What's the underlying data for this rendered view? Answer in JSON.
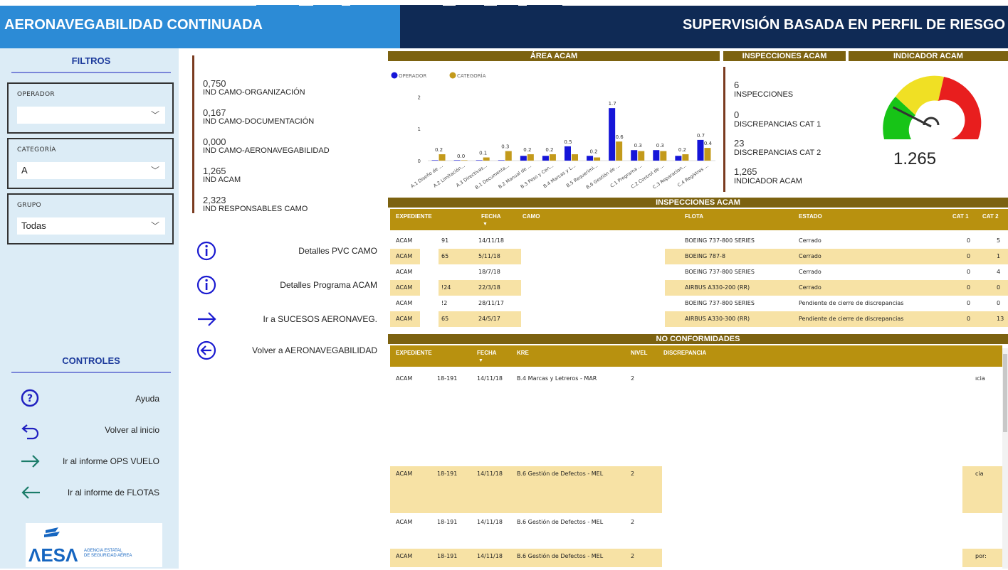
{
  "header": {
    "left_title": "AERONAVEGABILIDAD CONTINUADA",
    "right_title": "SUPERVISIÓN BASADA EN PERFIL DE RIESGO"
  },
  "filters": {
    "title": "FILTROS",
    "operador": {
      "label": "OPERADOR",
      "value": ""
    },
    "categoria": {
      "label": "CATEGORÍA",
      "value": "A"
    },
    "grupo": {
      "label": "GRUPO",
      "value": "Todas"
    }
  },
  "controls": {
    "title": "CONTROLES",
    "items": [
      {
        "label": "Ayuda",
        "icon": "help-icon"
      },
      {
        "label": "Volver al inicio",
        "icon": "back-arrow-icon"
      },
      {
        "label": "Ir al informe OPS VUELO",
        "icon": "arrow-right-icon"
      },
      {
        "label": "Ir al informe de FLOTAS",
        "icon": "arrow-left-icon"
      }
    ]
  },
  "logo": {
    "name": "AESA",
    "subtitle_1": "AGENCIA ESTATAL",
    "subtitle_2": "DE SEGURIDAD AÉREA"
  },
  "kpis": [
    {
      "value": "0,750",
      "label": "IND CAMO-ORGANIZACIÓN"
    },
    {
      "value": "0,167",
      "label": "IND CAMO-DOCUMENTACIÓN"
    },
    {
      "value": "0,000",
      "label": "IND CAMO-AERONAVEGABILIDAD"
    },
    {
      "value": "1,265",
      "label": "IND ACAM"
    },
    {
      "value": "2,323",
      "label": "IND RESPONSABLES CAMO"
    }
  ],
  "nav_links": [
    {
      "label": "Detalles PVC CAMO",
      "icon": "info-icon"
    },
    {
      "label": "Detalles Programa ACAM",
      "icon": "info-icon"
    },
    {
      "label": "Ir a SUCESOS AERONAVEG.",
      "icon": "arrow-right-icon"
    },
    {
      "label": "Volver a AERONAVEGABILIDAD",
      "icon": "circle-arrow-left-icon"
    }
  ],
  "sections": {
    "area_acam": "ÁREA ACAM",
    "inspecciones_acam": "INSPECCIONES ACAM",
    "indicador_acam": "INDICADOR ACAM",
    "inspecciones_table": "INSPECCIONES ACAM",
    "no_conformidades": "NO CONFORMIDADES"
  },
  "chart_data": {
    "type": "bar",
    "categories": [
      "A.1 Diseño de ...",
      "A.2 Limitación...",
      "A.3 Directivas...",
      "B.1 Documenta...",
      "B.2 Manual de ...",
      "B.3 Peso y Cen...",
      "B.4 Marcas y L...",
      "B.5 Requerimi...",
      "B.6 Gestión de ...",
      "C.1 Programa ...",
      "C.2 Control de ...",
      "C.3 Reparacion...",
      "C.4 Registros ..."
    ],
    "series": [
      {
        "name": "OPERADOR",
        "color": "#1515d8",
        "values": [
          0,
          0,
          0,
          0,
          0.15,
          0.15,
          0.45,
          0.15,
          1.65,
          0.33,
          0.33,
          0.15,
          0.65
        ]
      },
      {
        "name": "CATEGORÍA",
        "color": "#c39a1b",
        "values": [
          0.2,
          0.0,
          0.1,
          0.3,
          0.2,
          0.2,
          0.2,
          0.1,
          0.6,
          0.3,
          0.3,
          0.2,
          0.4
        ]
      }
    ],
    "data_labels": [
      "0.2",
      "0.0",
      "0.1",
      "0.3",
      "0.2",
      "0.2",
      "0.5",
      "0.2",
      "1.7",
      "0.6",
      "0.3",
      "0.3",
      "0.2",
      "0.7",
      "0.4"
    ],
    "y_ticks": [
      "0",
      "1",
      "2"
    ],
    "ylim": [
      0,
      2.1
    ],
    "legend_position": "top-left",
    "grid": false
  },
  "inspection_kpis": [
    {
      "value": "6",
      "label": "INSPECCIONES"
    },
    {
      "value": "0",
      "label": "DISCREPANCIAS CAT 1"
    },
    {
      "value": "23",
      "label": "DISCREPANCIAS CAT 2"
    },
    {
      "value": "1,265",
      "label": "INDICADOR ACAM"
    }
  ],
  "gauge": {
    "value": "1.265",
    "level": 0.2
  },
  "inspections_table": {
    "columns": [
      "EXPEDIENTE",
      "FECHA",
      "CAMO",
      "FLOTA",
      "ESTADO",
      "CAT 1",
      "CAT 2"
    ],
    "rows": [
      {
        "exp": "ACAM",
        "num": "91",
        "fecha": "14/11/18",
        "flota": "BOEING 737-800 SERIES",
        "estado": "Cerrado",
        "cat1": "0",
        "cat2": "5",
        "hl": false
      },
      {
        "exp": "ACAM",
        "num": "65",
        "fecha": "5/11/18",
        "flota": "BOEING 787-8",
        "estado": "Cerrado",
        "cat1": "0",
        "cat2": "1",
        "hl": true
      },
      {
        "exp": "ACAM",
        "num": "",
        "fecha": "18/7/18",
        "flota": "BOEING 737-800 SERIES",
        "estado": "Cerrado",
        "cat1": "0",
        "cat2": "4",
        "hl": false
      },
      {
        "exp": "ACAM",
        "num": "!24",
        "fecha": "22/3/18",
        "flota": "AIRBUS A330-200 (RR)",
        "estado": "Cerrado",
        "cat1": "0",
        "cat2": "0",
        "hl": true
      },
      {
        "exp": "ACAM",
        "num": "!2",
        "fecha": "28/11/17",
        "flota": "BOEING 737-800 SERIES",
        "estado": "Pendiente de cierre de discrepancias",
        "cat1": "0",
        "cat2": "0",
        "hl": false
      },
      {
        "exp": "ACAM",
        "num": "65",
        "fecha": "24/5/17",
        "flota": "AIRBUS A330-300 (RR)",
        "estado": "Pendiente de cierre de discrepancias",
        "cat1": "0",
        "cat2": "13",
        "hl": true
      }
    ]
  },
  "nc_table": {
    "columns": [
      "EXPEDIENTE",
      "FECHA",
      "KRE",
      "NIVEL",
      "DISCREPANCIA"
    ],
    "rows": [
      {
        "exp": "ACAM",
        "num": "18-191",
        "fecha": "14/11/18",
        "kre": "B.4 Marcas y Letreros - MAR",
        "nivel": "2",
        "tail": "ıcia",
        "hl": false
      },
      {
        "exp": "ACAM",
        "num": "18-191",
        "fecha": "14/11/18",
        "kre": "B.6 Gestión de Defectos - MEL",
        "nivel": "2",
        "tail": "cia",
        "hl": true
      },
      {
        "exp": "ACAM",
        "num": "18-191",
        "fecha": "14/11/18",
        "kre": "B.6 Gestión de Defectos - MEL",
        "nivel": "2",
        "tail": "",
        "hl": false
      },
      {
        "exp": "ACAM",
        "num": "18-191",
        "fecha": "14/11/18",
        "kre": "B.6 Gestión de Defectos - MEL",
        "nivel": "2",
        "tail": "por:",
        "hl": true
      }
    ]
  }
}
